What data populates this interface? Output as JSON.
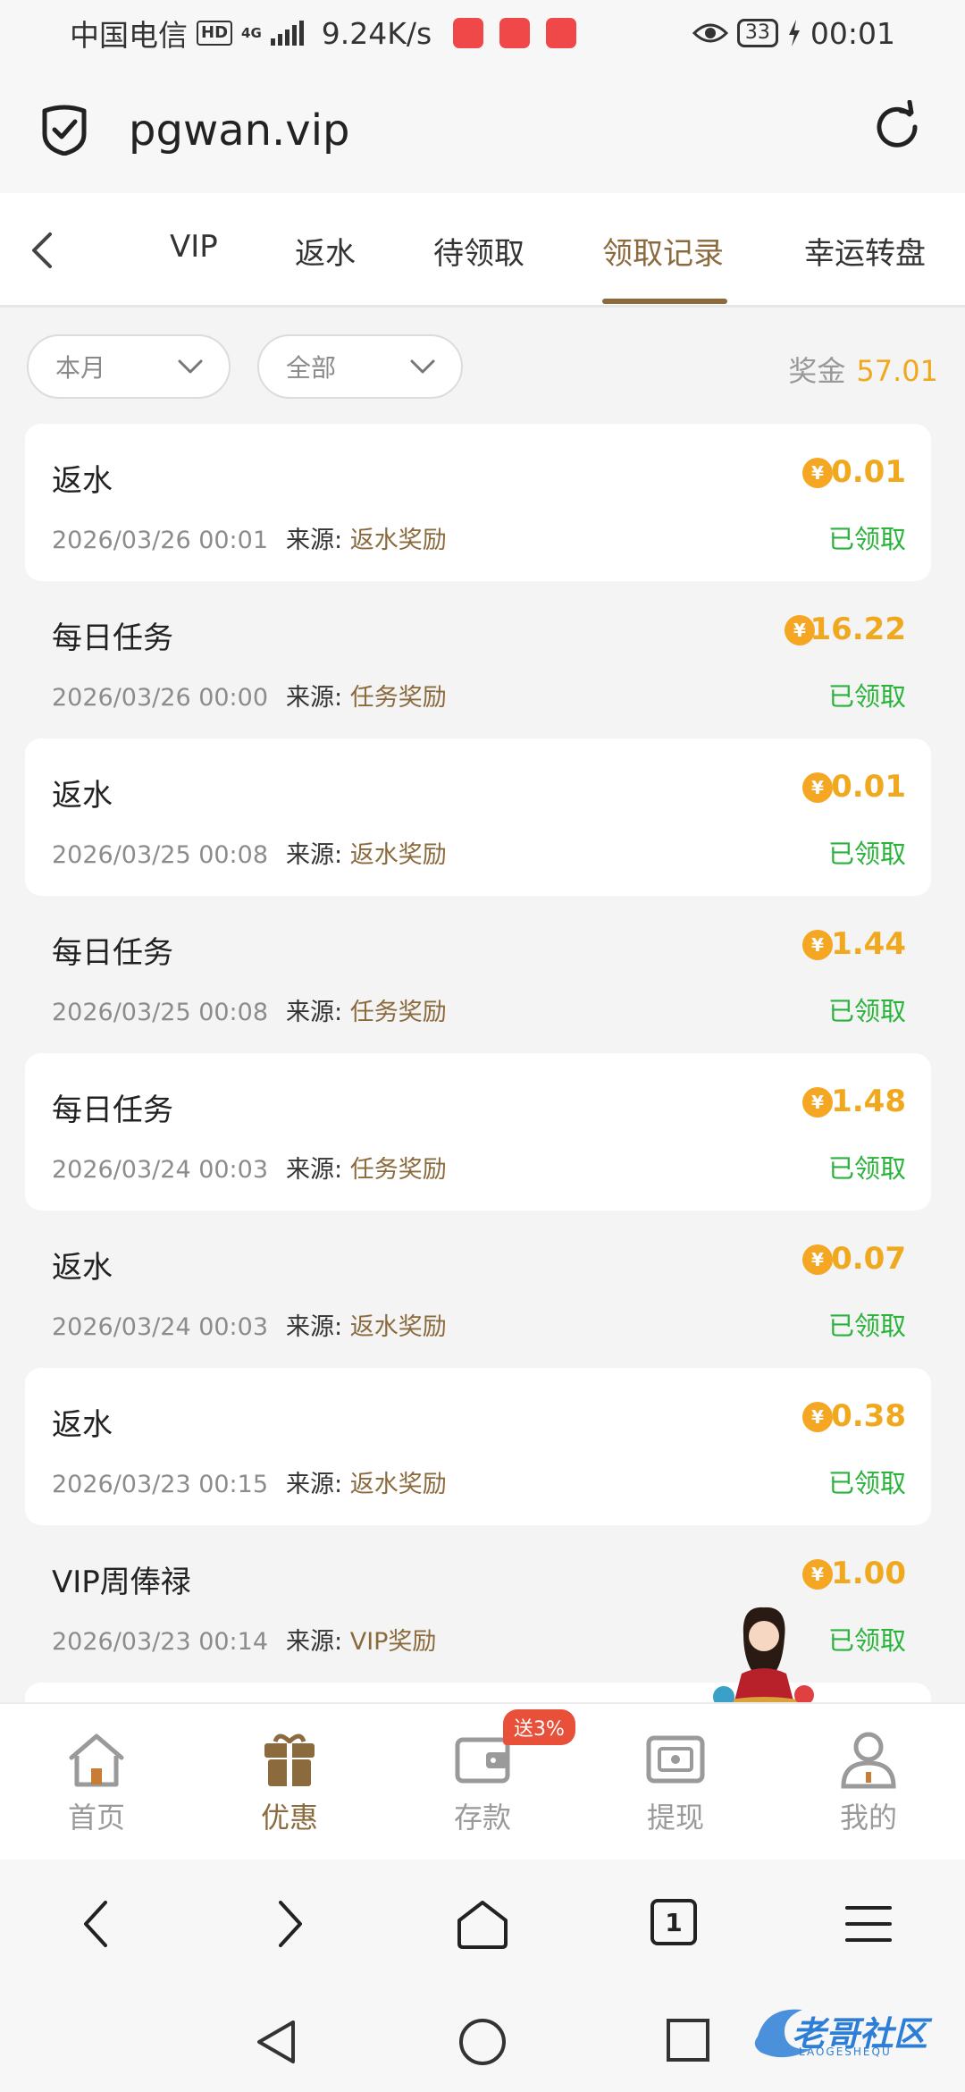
{
  "status_bar": {
    "carrier": "中国电信",
    "hd": "HD",
    "network": "4G",
    "speed": "9.24K/s",
    "battery": "33",
    "time": "00:01"
  },
  "browser": {
    "domain": "pgwan.vip"
  },
  "tabs": [
    {
      "label": "VIP"
    },
    {
      "label": "返水"
    },
    {
      "label": "待领取"
    },
    {
      "label": "领取记录"
    },
    {
      "label": "幸运转盘"
    }
  ],
  "active_tab": "领取记录",
  "filters": {
    "period": "本月",
    "type": "全部",
    "bonus_label": "奖金",
    "bonus_value": "57.01"
  },
  "records": [
    {
      "title": "返水",
      "date": "2026/03/26 00:01",
      "source_label": "来源:",
      "source": "返水奖励",
      "amount": "0.01",
      "status": "已领取"
    },
    {
      "title": "每日任务",
      "date": "2026/03/26 00:00",
      "source_label": "来源:",
      "source": "任务奖励",
      "amount": "16.22",
      "status": "已领取"
    },
    {
      "title": "返水",
      "date": "2026/03/25 00:08",
      "source_label": "来源:",
      "source": "返水奖励",
      "amount": "0.01",
      "status": "已领取"
    },
    {
      "title": "每日任务",
      "date": "2026/03/25 00:08",
      "source_label": "来源:",
      "source": "任务奖励",
      "amount": "1.44",
      "status": "已领取"
    },
    {
      "title": "每日任务",
      "date": "2026/03/24 00:03",
      "source_label": "来源:",
      "source": "任务奖励",
      "amount": "1.48",
      "status": "已领取"
    },
    {
      "title": "返水",
      "date": "2026/03/24 00:03",
      "source_label": "来源:",
      "source": "返水奖励",
      "amount": "0.07",
      "status": "已领取"
    },
    {
      "title": "返水",
      "date": "2026/03/23 00:15",
      "source_label": "来源:",
      "source": "返水奖励",
      "amount": "0.38",
      "status": "已领取"
    },
    {
      "title": "VIP周俸禄",
      "date": "2026/03/23 00:14",
      "source_label": "来源:",
      "source": "VIP奖励",
      "amount": "1.00",
      "status": "已领取"
    }
  ],
  "coin_symbol": "¥",
  "app_nav": [
    {
      "label": "首页",
      "icon": "home-icon"
    },
    {
      "label": "优惠",
      "icon": "gift-icon"
    },
    {
      "label": "存款",
      "icon": "wallet-icon"
    },
    {
      "label": "提现",
      "icon": "withdraw-icon"
    },
    {
      "label": "我的",
      "icon": "user-icon"
    }
  ],
  "deposit_badge": "送3%",
  "browser_nav": {
    "tab_count": "1"
  },
  "watermark": {
    "text": "老哥社区",
    "sub": "LAOGESHEQU"
  },
  "colors": {
    "accent": "#8b6a3e",
    "amount": "#f0a81e",
    "status": "#2ab33a",
    "badge": "#e8503a"
  }
}
